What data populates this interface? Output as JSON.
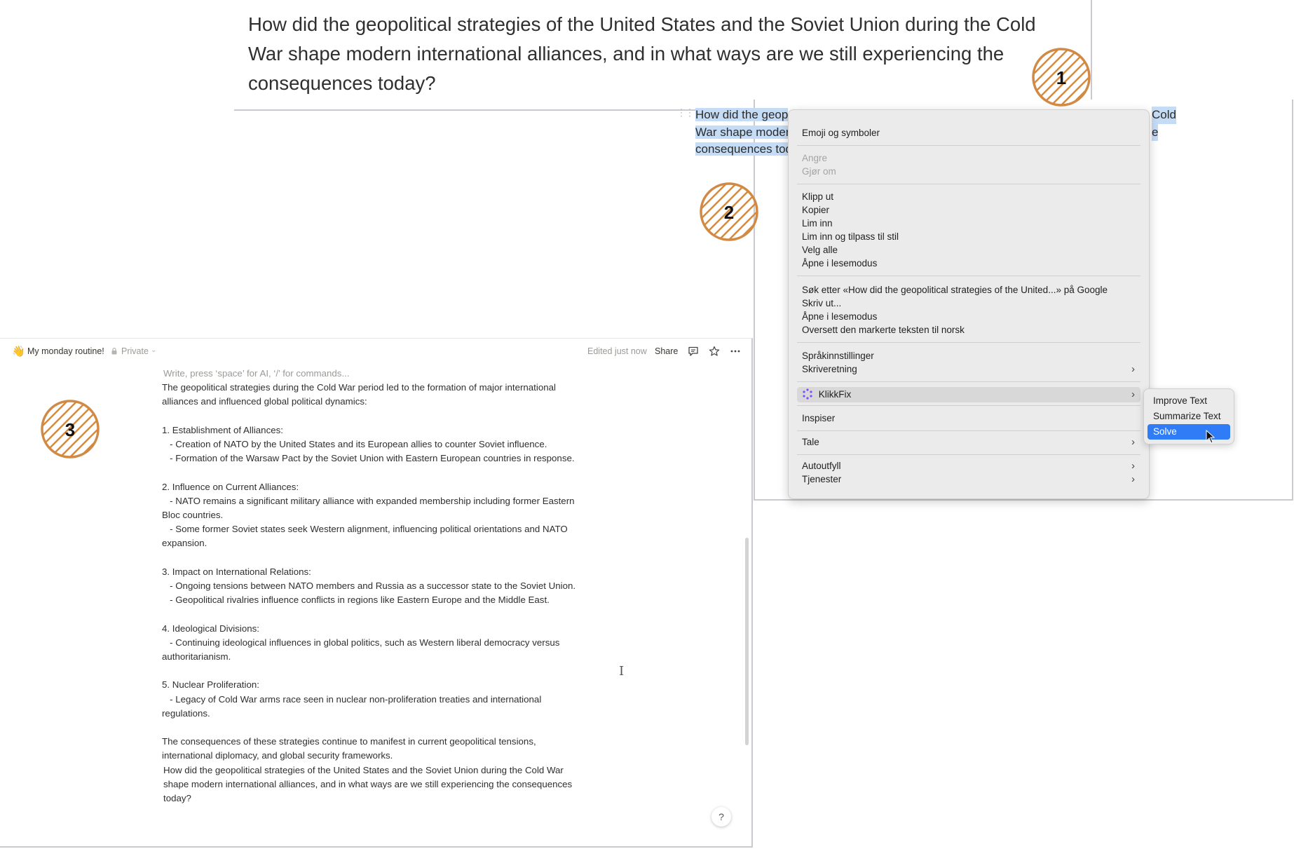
{
  "panel1": {
    "question": "How did the geopolitical strategies of the United States and the Soviet Union during the Cold War shape modern international alliances, and in what ways are we still experiencing the consequences today?"
  },
  "panel2": {
    "selected_lines": [
      "How did the geop",
      "War shape moder",
      "consequences tod"
    ],
    "selected_tail": [
      "Cold",
      "e"
    ],
    "context_menu": {
      "items": {
        "emoji": "Emoji og symboler",
        "undo": "Angre",
        "redo": "Gjør om",
        "cut": "Klipp ut",
        "copy": "Kopier",
        "paste": "Lim inn",
        "paste_match": "Lim inn og tilpass til stil",
        "select_all": "Velg alle",
        "open_reader_1": "Åpne i lesemodus",
        "search_google": "Søk etter «How did the geopolitical strategies of the United...» på Google",
        "print": "Skriv ut...",
        "open_reader_2": "Åpne i lesemodus",
        "translate": "Oversett den markerte teksten til norsk",
        "language_settings": "Språkinnstillinger",
        "writing_direction": "Skriveretning",
        "klikkfix": "KlikkFix",
        "inspect": "Inspiser",
        "speech": "Tale",
        "autofill": "Autoutfyll",
        "services": "Tjenester"
      },
      "chevron": "›"
    },
    "submenu": {
      "items": [
        "Improve Text",
        "Summarize Text",
        "Solve"
      ],
      "active": "Solve",
      "active_color": "#2f7cf6"
    }
  },
  "panel3": {
    "topbar": {
      "emoji": "👋",
      "doc_title": "My monday routine!",
      "privacy": "Private",
      "privacy_chevron": "⌄",
      "edited": "Edited just now",
      "share": "Share"
    },
    "placeholder": "Write, press ‘space’ for AI, ‘/’ for commands...",
    "ai_response": "The geopolitical strategies during the Cold War period led to the formation of major international alliances and influenced global political dynamics:\n\n1. Establishment of Alliances:\n   - Creation of NATO by the United States and its European allies to counter Soviet influence.\n   - Formation of the Warsaw Pact by the Soviet Union with Eastern European countries in response.\n\n2. Influence on Current Alliances:\n   - NATO remains a significant military alliance with expanded membership including former Eastern Bloc countries.\n   - Some former Soviet states seek Western alignment, influencing political orientations and NATO expansion.\n\n3. Impact on International Relations:\n   - Ongoing tensions between NATO members and Russia as a successor state to the Soviet Union.\n   - Geopolitical rivalries influence conflicts in regions like Eastern Europe and the Middle East.\n\n4. Ideological Divisions:\n   - Continuing ideological influences in global politics, such as Western liberal democracy versus authoritarianism.\n\n5. Nuclear Proliferation:\n   - Legacy of Cold War arms race seen in nuclear non-proliferation treaties and international regulations.\n\nThe consequences of these strategies continue to manifest in current geopolitical tensions, international diplomacy, and global security frameworks.",
    "question": "How did the geopolitical strategies of the United States and the Soviet Union during the Cold War shape modern international alliances, and in what ways are we still experiencing the consequences today?",
    "help_symbol": "?"
  },
  "badges": {
    "one": "1",
    "two": "2",
    "three": "3",
    "color": "#d08a45"
  }
}
